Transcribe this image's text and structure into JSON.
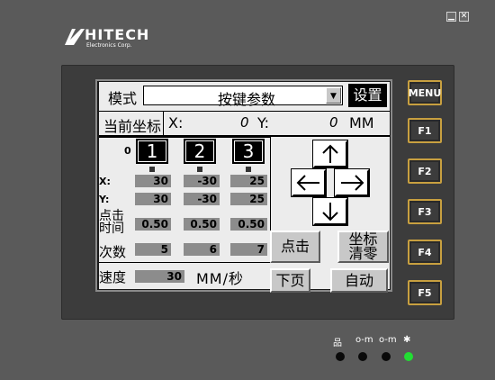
{
  "titlebar": {
    "minimize_glyph": "▁",
    "close_glyph": "✕"
  },
  "logo": {
    "brand": "HITECH",
    "subtitle": "Electronics Corp."
  },
  "screen": {
    "mode_label": "模式",
    "mode_value": "按键参数",
    "dropdown_glyph": "▼",
    "settings_label": "设置",
    "coord_label": "当前坐标",
    "x_label": "X:",
    "x_value": "0",
    "y_label": "Y:",
    "y_value": "0",
    "unit_mm": "MM",
    "zero_label": "0",
    "axis_buttons": [
      "1",
      "2",
      "3"
    ],
    "row_x_label": "X:",
    "row_y_label": "Y:",
    "click_time_label_1": "点击",
    "click_time_label_2": "时间",
    "count_label": "次数",
    "x_values": [
      "30",
      "-30",
      "25"
    ],
    "y_values": [
      "30",
      "-30",
      "25"
    ],
    "time_values": [
      "0.50",
      "0.50",
      "0.50"
    ],
    "count_values": [
      "5",
      "6",
      "7"
    ],
    "speed_label": "速度",
    "speed_value": "30",
    "speed_unit": "MM/秒",
    "click_button": "点击",
    "clear_button_1": "坐标",
    "clear_button_2": "清零",
    "next_page_button": "下页",
    "auto_button": "自动"
  },
  "function_keys": [
    "MENU",
    "F1",
    "F2",
    "F3",
    "F4",
    "F5"
  ],
  "status_leds": [
    {
      "icon": "network-icon",
      "glyph": "品",
      "state": "off"
    },
    {
      "icon": "key-icon",
      "glyph": "o-m",
      "state": "off"
    },
    {
      "icon": "key-icon",
      "glyph": "o-m",
      "state": "off"
    },
    {
      "icon": "power-icon",
      "glyph": "✱",
      "state": "on",
      "color": "#22dd33"
    }
  ]
}
